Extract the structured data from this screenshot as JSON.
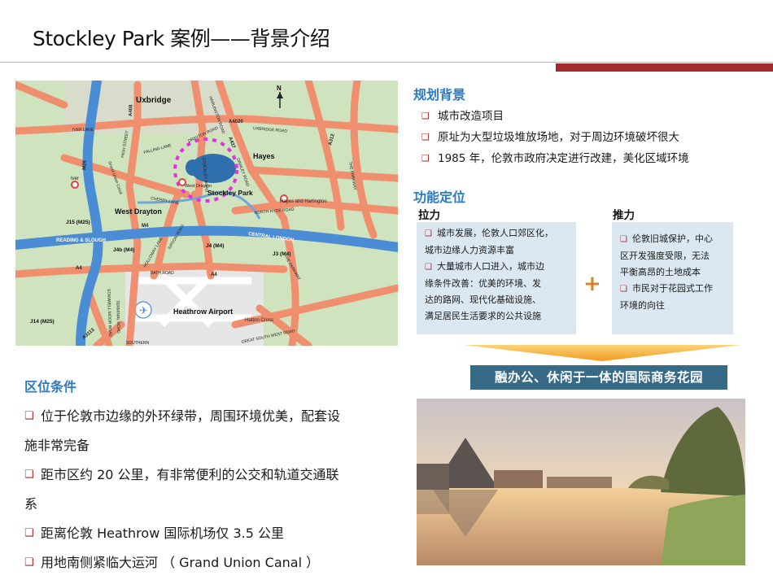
{
  "header": {
    "title": "Stockley Park  案例——背景介绍"
  },
  "map": {
    "labels": {
      "north": "N",
      "uxbridge": "Uxbridge",
      "hayes": "Hayes",
      "west_drayton_town": "West Drayton",
      "west_drayton_station": "West Drayton",
      "stockley_park": "Stockley Park",
      "hayes_harlington": "Hayes and Harlington",
      "heathrow": "Heathrow Airport",
      "hatton_cross": "Hatton Cross",
      "iver": "Iver",
      "iver_lane": "IVER LANE",
      "m25": "M25",
      "j15": "J15 (M25)",
      "j14": "J14 (M25)",
      "j4b": "J4b (M4)",
      "j4": "J4 (M4)",
      "j3": "J3 (M4)",
      "m4": "M4",
      "a4": "A4",
      "a408": "A408",
      "a4020": "A4020",
      "a437": "A437",
      "a312": "A312",
      "a3113": "A3113",
      "reading_slough": "READING & SLOUGH",
      "central_london": "CENTRAL LONDON",
      "grand_union_canal": "Grand Union Canal",
      "high_street": "HIGH STREET",
      "falling_lane": "FALLING LANE",
      "cherry_lane": "CHERRY LANE",
      "north_hyde_road": "NORTH HYDE ROAD",
      "uxbridge_road": "UXBRIDGE ROAD",
      "the_parkway": "THE PARKWAY",
      "bath_road": "BATH ROAD",
      "sipson_road": "SIPSON ROAD",
      "holloway_lane": "HOLLOWAY LANE",
      "stockley_road": "STOCKLEY ROAD",
      "harlington_road": "HARLINGTON ROAD",
      "drayton_road": "DRAYTON ROAD",
      "dawley_road": "DAWLEY ROAD",
      "great_south_west_road": "GREAT SOUTH WEST ROAD",
      "southern_perimeter": "SOUTHERN",
      "stanwell_moor_road": "STANWELL MOOR ROAD",
      "terminal_road": "TERMINAL ROAD"
    }
  },
  "planning": {
    "heading": "规划背景",
    "items": [
      "城市改造项目",
      "原址为大型垃圾堆放场地，对于周边环境破坏很大",
      "1985 年，伦敦市政府决定进行改建，美化区域环境"
    ]
  },
  "function": {
    "heading": "功能定位",
    "pull": {
      "label": "拉力",
      "items": [
        [
          "城市发展，伦敦人口郊区化，",
          "城市边缘人力资源丰富"
        ],
        [
          "大量城市人口进入，城市边",
          "缘条件改善：优美的环境、发",
          "达的路网、现代化基础设施、",
          "满足居民生活要求的公共设施"
        ]
      ]
    },
    "push": {
      "label": "推力",
      "items": [
        [
          "伦敦旧城保护，中心",
          "区开发强度受限，无法",
          "平衡高昂的土地成本"
        ],
        [
          "市民对于花园式工作",
          "环境的向往"
        ]
      ]
    },
    "plus": "+",
    "result": "融办公、休闲于一体的国际商务花园"
  },
  "location": {
    "heading": "区位条件",
    "lines": [
      {
        "bullet": true,
        "text": "位于伦敦市边缘的外环绿带，周围环境优美，配套设"
      },
      {
        "bullet": false,
        "text": "施非常完备"
      },
      {
        "bullet": true,
        "text": "距市区约 20 公里，有非常便利的公交和轨道交通联"
      },
      {
        "bullet": false,
        "text": "系"
      },
      {
        "bullet": true,
        "text": "距离伦敦 Heathrow 国际机场仅 3.5 公里"
      },
      {
        "bullet": true,
        "text": "用地南侧紧临大运河 （ Grand Union Canal ）"
      }
    ]
  },
  "icons": {
    "bullet": "hollow-square-icon",
    "airport": "airplane-icon",
    "arrow": "down-arrow-icon",
    "north": "north-arrow-icon"
  },
  "colors": {
    "accent_red": "#a32a2a",
    "heading_blue": "#2b7bc4",
    "banner": "#366a87",
    "box": "#dbe8f1",
    "arrow_orange": "#f5a623",
    "map_green": "#cfe3be",
    "road": "#ef8f6e",
    "motorway": "#4a8dd4"
  }
}
